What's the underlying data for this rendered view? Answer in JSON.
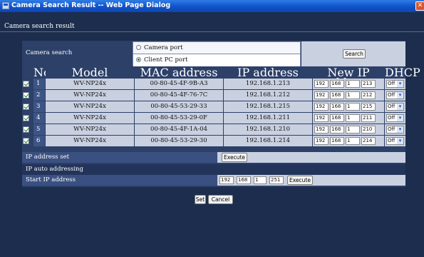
{
  "window": {
    "title": "Camera Search Result -- Web Page Dialog",
    "close_glyph": "✕"
  },
  "page": {
    "heading": "Camera search result"
  },
  "search": {
    "label": "Camera search",
    "options": [
      "Camera port",
      "Client PC port"
    ],
    "selected": "Client PC port",
    "button_label": "Search"
  },
  "table": {
    "columns": {
      "no": "No.",
      "model": "Model",
      "mac": "MAC address",
      "ip": "IP address",
      "new_ip": "New IP address",
      "dhcp": "DHCP"
    },
    "rows": [
      {
        "checked": true,
        "no": "1",
        "model": "WV-NP24x",
        "mac": "00-80-45-4F-9B-A3",
        "ip": "192.168.1.213",
        "new_ip": [
          "192",
          "168",
          "1",
          "213"
        ],
        "dhcp": "Off"
      },
      {
        "checked": true,
        "no": "2",
        "model": "WV-NP24x",
        "mac": "00-80-45-4F-76-7C",
        "ip": "192.168.1.212",
        "new_ip": [
          "192",
          "168",
          "1",
          "212"
        ],
        "dhcp": "Off"
      },
      {
        "checked": true,
        "no": "3",
        "model": "WV-NP24x",
        "mac": "00-80-45-53-29-33",
        "ip": "192.168.1.215",
        "new_ip": [
          "192",
          "168",
          "1",
          "215"
        ],
        "dhcp": "Off"
      },
      {
        "checked": true,
        "no": "4",
        "model": "WV-NP24x",
        "mac": "00-80-45-53-29-0F",
        "ip": "192.168.1.211",
        "new_ip": [
          "192",
          "168",
          "1",
          "211"
        ],
        "dhcp": "Off"
      },
      {
        "checked": true,
        "no": "5",
        "model": "WV-NP24x",
        "mac": "00-80-45-4F-1A-04",
        "ip": "192.168.1.210",
        "new_ip": [
          "192",
          "168",
          "1",
          "210"
        ],
        "dhcp": "Off"
      },
      {
        "checked": true,
        "no": "6",
        "model": "WV-NP24x",
        "mac": "00-80-45-53-29-30",
        "ip": "192.168.1.214",
        "new_ip": [
          "192",
          "168",
          "1",
          "214"
        ],
        "dhcp": "Off"
      }
    ]
  },
  "ip_address_set": {
    "label": "IP address set",
    "button_label": "Execute"
  },
  "ip_auto": {
    "label": "IP auto addressing"
  },
  "start_ip": {
    "label": "Start IP address",
    "octets": [
      "192",
      "168",
      "1",
      "251"
    ],
    "button_label": "Execute"
  },
  "footer": {
    "set_label": "Set",
    "cancel_label": "Cancel"
  },
  "icons": {
    "window_icon": "camera-app-icon",
    "close": "close-icon",
    "dropdown": "chevron-down-icon"
  }
}
